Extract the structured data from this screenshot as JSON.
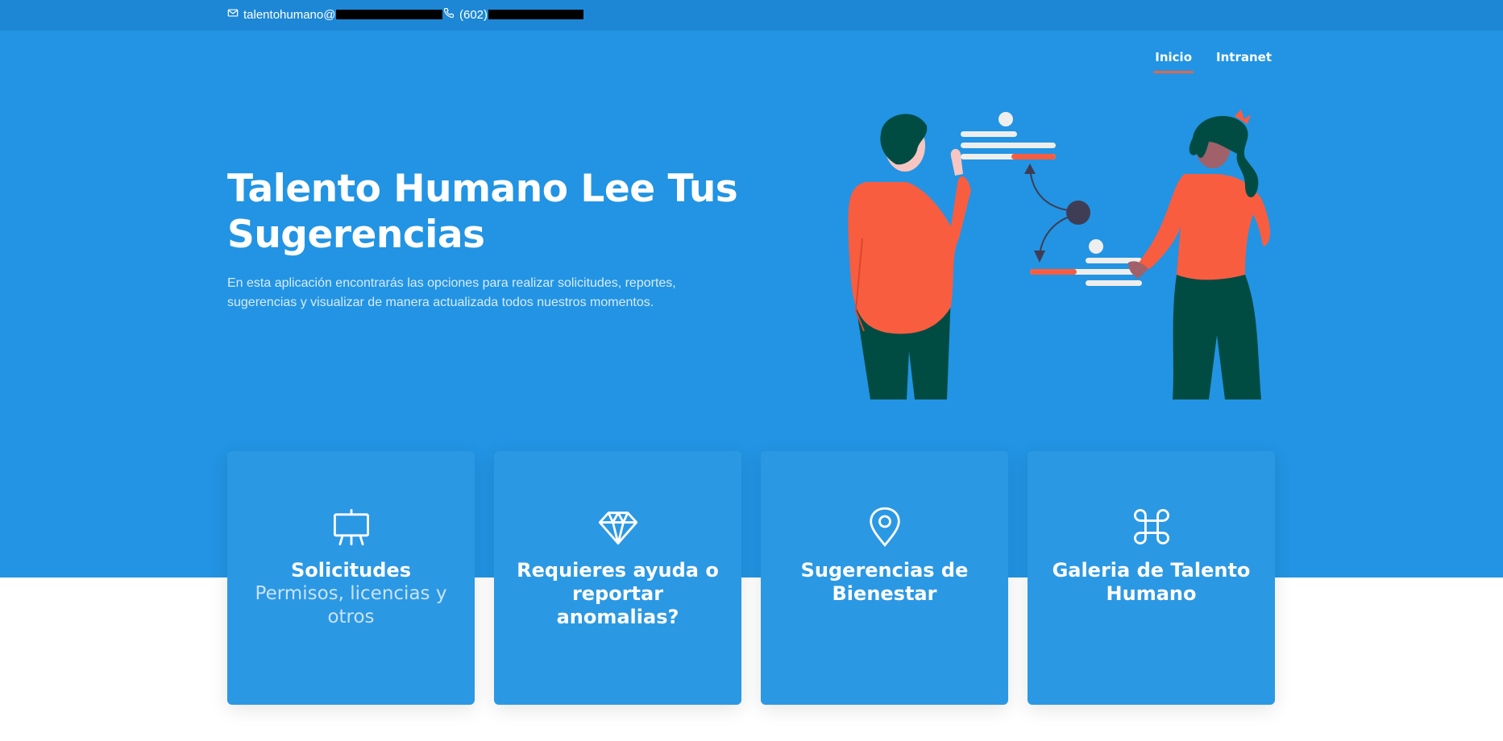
{
  "topbar": {
    "email": "talentohumano@",
    "phone": "(602)"
  },
  "nav": {
    "items": [
      "Inicio",
      "Intranet"
    ]
  },
  "hero": {
    "title": "Talento Humano Lee Tus Sugerencias",
    "description": "En esta aplicación encontrarás las opciones para realizar solicitudes, reportes, sugerencias y visualizar de manera actualizada todos nuestros momentos."
  },
  "cards": [
    {
      "title": "Solicitudes",
      "subtitle": "Permisos, licencias y otros",
      "icon": "presentation-board-icon"
    },
    {
      "title": "Requieres ayuda o reportar anomalias?",
      "subtitle": "",
      "icon": "diamond-icon"
    },
    {
      "title": "Sugerencias de Bienestar",
      "subtitle": "",
      "icon": "map-pin-icon"
    },
    {
      "title": "Galeria de Talento Humano",
      "subtitle": "",
      "icon": "command-icon"
    }
  ],
  "colors": {
    "topbar": "#1d87d5",
    "hero": "#2294e3",
    "card": "#2b98e4",
    "accent": "#e0674d",
    "shirt": "#f95d40",
    "pants": "#004c43"
  }
}
